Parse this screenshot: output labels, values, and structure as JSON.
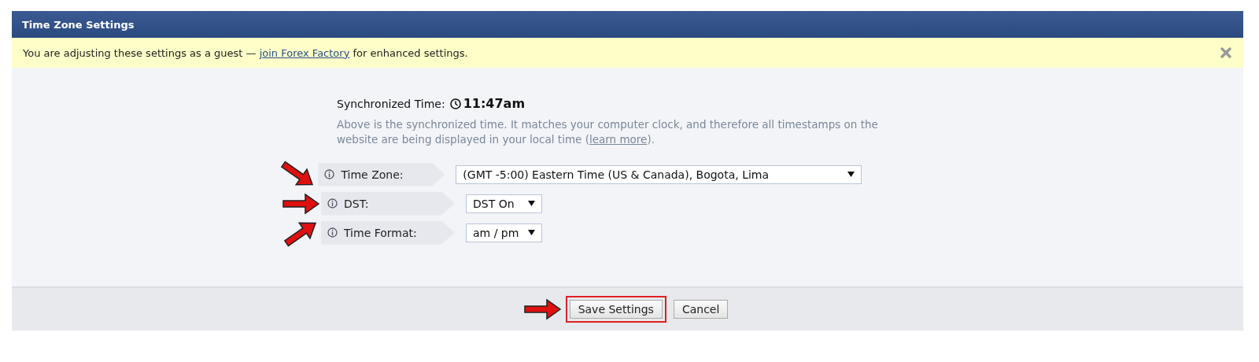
{
  "panel": {
    "title": "Time Zone Settings"
  },
  "notice": {
    "before": "You are adjusting these settings as a guest — ",
    "link": "join Forex Factory",
    "after": " for enhanced settings."
  },
  "sync": {
    "label": "Synchronized Time:",
    "time": "11:47am",
    "description": "Above is the synchronized time. It matches your computer clock, and therefore all timestamps on the website are being displayed in your local time (",
    "link": "learn more",
    "description_end": ")."
  },
  "fields": [
    {
      "label": "Time Zone:",
      "value": "(GMT -5:00) Eastern Time (US & Canada), Bogota, Lima",
      "wide": true,
      "kind": "arrowdown"
    },
    {
      "label": "DST:",
      "value": "DST On",
      "wide": false,
      "kind": "arrowright"
    },
    {
      "label": "Time Format:",
      "value": "am / pm",
      "wide": false,
      "kind": "arrowup"
    }
  ],
  "buttons": [
    {
      "label": "Save Settings",
      "callout": true
    },
    {
      "label": "Cancel",
      "callout": false
    }
  ]
}
